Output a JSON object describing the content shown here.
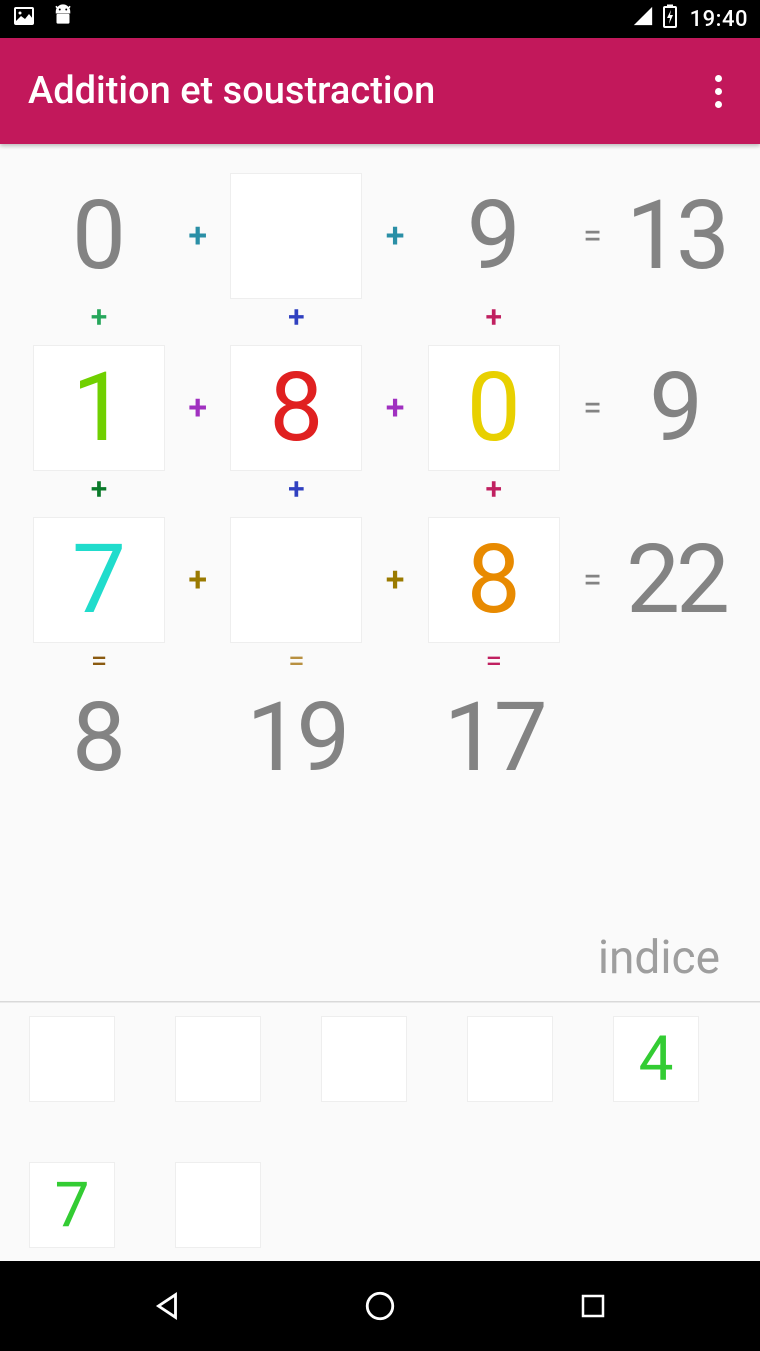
{
  "status": {
    "time": "19:40"
  },
  "appbar": {
    "title": "Addition et soustraction"
  },
  "grid": {
    "r1": {
      "a": "0",
      "op1": "+",
      "b": "",
      "op2": "+",
      "c": "9",
      "eq": "=",
      "res": "13"
    },
    "v1": {
      "a": "+",
      "b": "+",
      "c": "+"
    },
    "r2": {
      "a": "1",
      "op1": "+",
      "b": "8",
      "op2": "+",
      "c": "0",
      "eq": "=",
      "res": "9"
    },
    "v2": {
      "a": "+",
      "b": "+",
      "c": "+"
    },
    "r3": {
      "a": "7",
      "op1": "+",
      "b": "",
      "op2": "+",
      "c": "8",
      "eq": "=",
      "res": "22"
    },
    "v3": {
      "a": "=",
      "b": "=",
      "c": "="
    },
    "r4": {
      "a": "8",
      "b": "19",
      "c": "17"
    }
  },
  "hint": {
    "label": "indice"
  },
  "tiles": [
    "",
    "",
    "",
    "",
    "4",
    "7",
    ""
  ],
  "colors": {
    "tile5": "#33cc33",
    "tile6": "#33cc33"
  }
}
